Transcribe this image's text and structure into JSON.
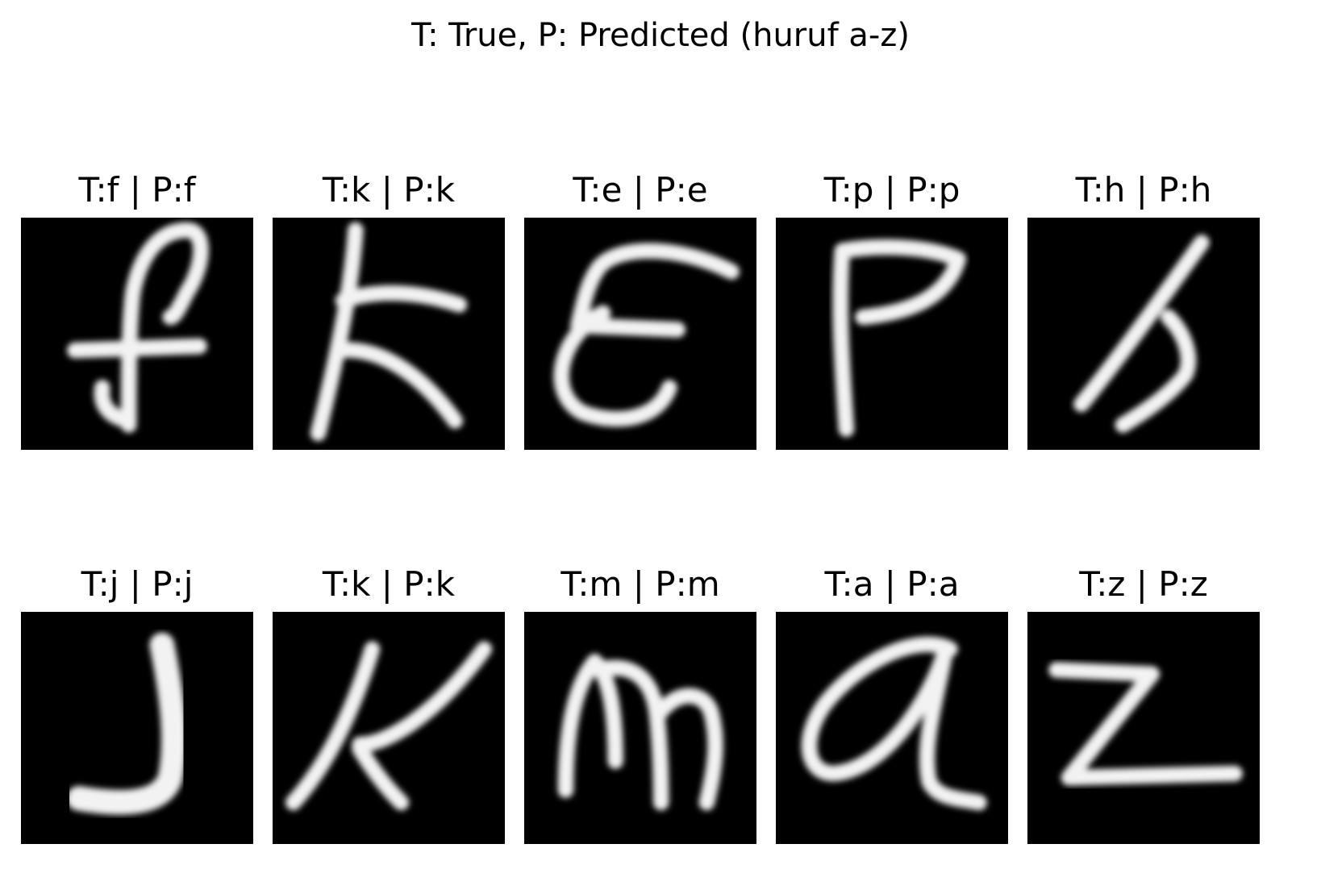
{
  "figure": {
    "suptitle": "T: True, P: Predicted (huruf a-z)"
  },
  "panels": [
    {
      "title": "T:f | P:f",
      "true_label": "f",
      "predicted_label": "f",
      "glyph": "f"
    },
    {
      "title": "T:k | P:k",
      "true_label": "k",
      "predicted_label": "k",
      "glyph": "k"
    },
    {
      "title": "T:e | P:e",
      "true_label": "e",
      "predicted_label": "e",
      "glyph": "e"
    },
    {
      "title": "T:p | P:p",
      "true_label": "p",
      "predicted_label": "p",
      "glyph": "p"
    },
    {
      "title": "T:h | P:h",
      "true_label": "h",
      "predicted_label": "h",
      "glyph": "h"
    },
    {
      "title": "T:j | P:j",
      "true_label": "j",
      "predicted_label": "j",
      "glyph": "j"
    },
    {
      "title": "T:k | P:k",
      "true_label": "k",
      "predicted_label": "k",
      "glyph": "k2"
    },
    {
      "title": "T:m | P:m",
      "true_label": "m",
      "predicted_label": "m",
      "glyph": "m"
    },
    {
      "title": "T:a | P:a",
      "true_label": "a",
      "predicted_label": "a",
      "glyph": "a"
    },
    {
      "title": "T:z | P:z",
      "true_label": "z",
      "predicted_label": "z",
      "glyph": "z"
    }
  ],
  "colors": {
    "image_background": "#000000",
    "stroke": "#f2f2f2",
    "page_background": "#ffffff"
  }
}
